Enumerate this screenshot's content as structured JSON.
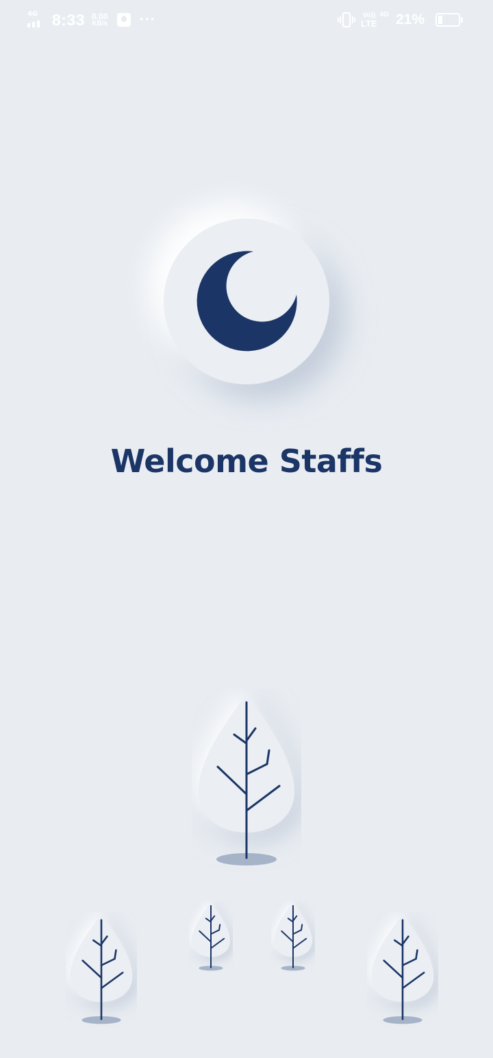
{
  "status_bar": {
    "network_type": "4G",
    "time": "8:33",
    "data_speed_value": "0.00",
    "data_speed_unit": "KB/s",
    "more_indicator": "···",
    "volte_label": "Vo))",
    "lte_label": "LTE",
    "lte_network": "4G",
    "battery_percent": "21%",
    "battery_level": 0.21
  },
  "app": {
    "logo_icon": "crescent-moon-icon",
    "welcome_title": "Welcome Staffs"
  },
  "colors": {
    "background": "#e9edf2",
    "primary": "#1b3566",
    "tree_shadow": "#a7b4c8"
  },
  "decorations": {
    "trees": [
      "tree-large",
      "tree-small-left",
      "tree-mini-left",
      "tree-mini-right",
      "tree-small-right"
    ]
  }
}
